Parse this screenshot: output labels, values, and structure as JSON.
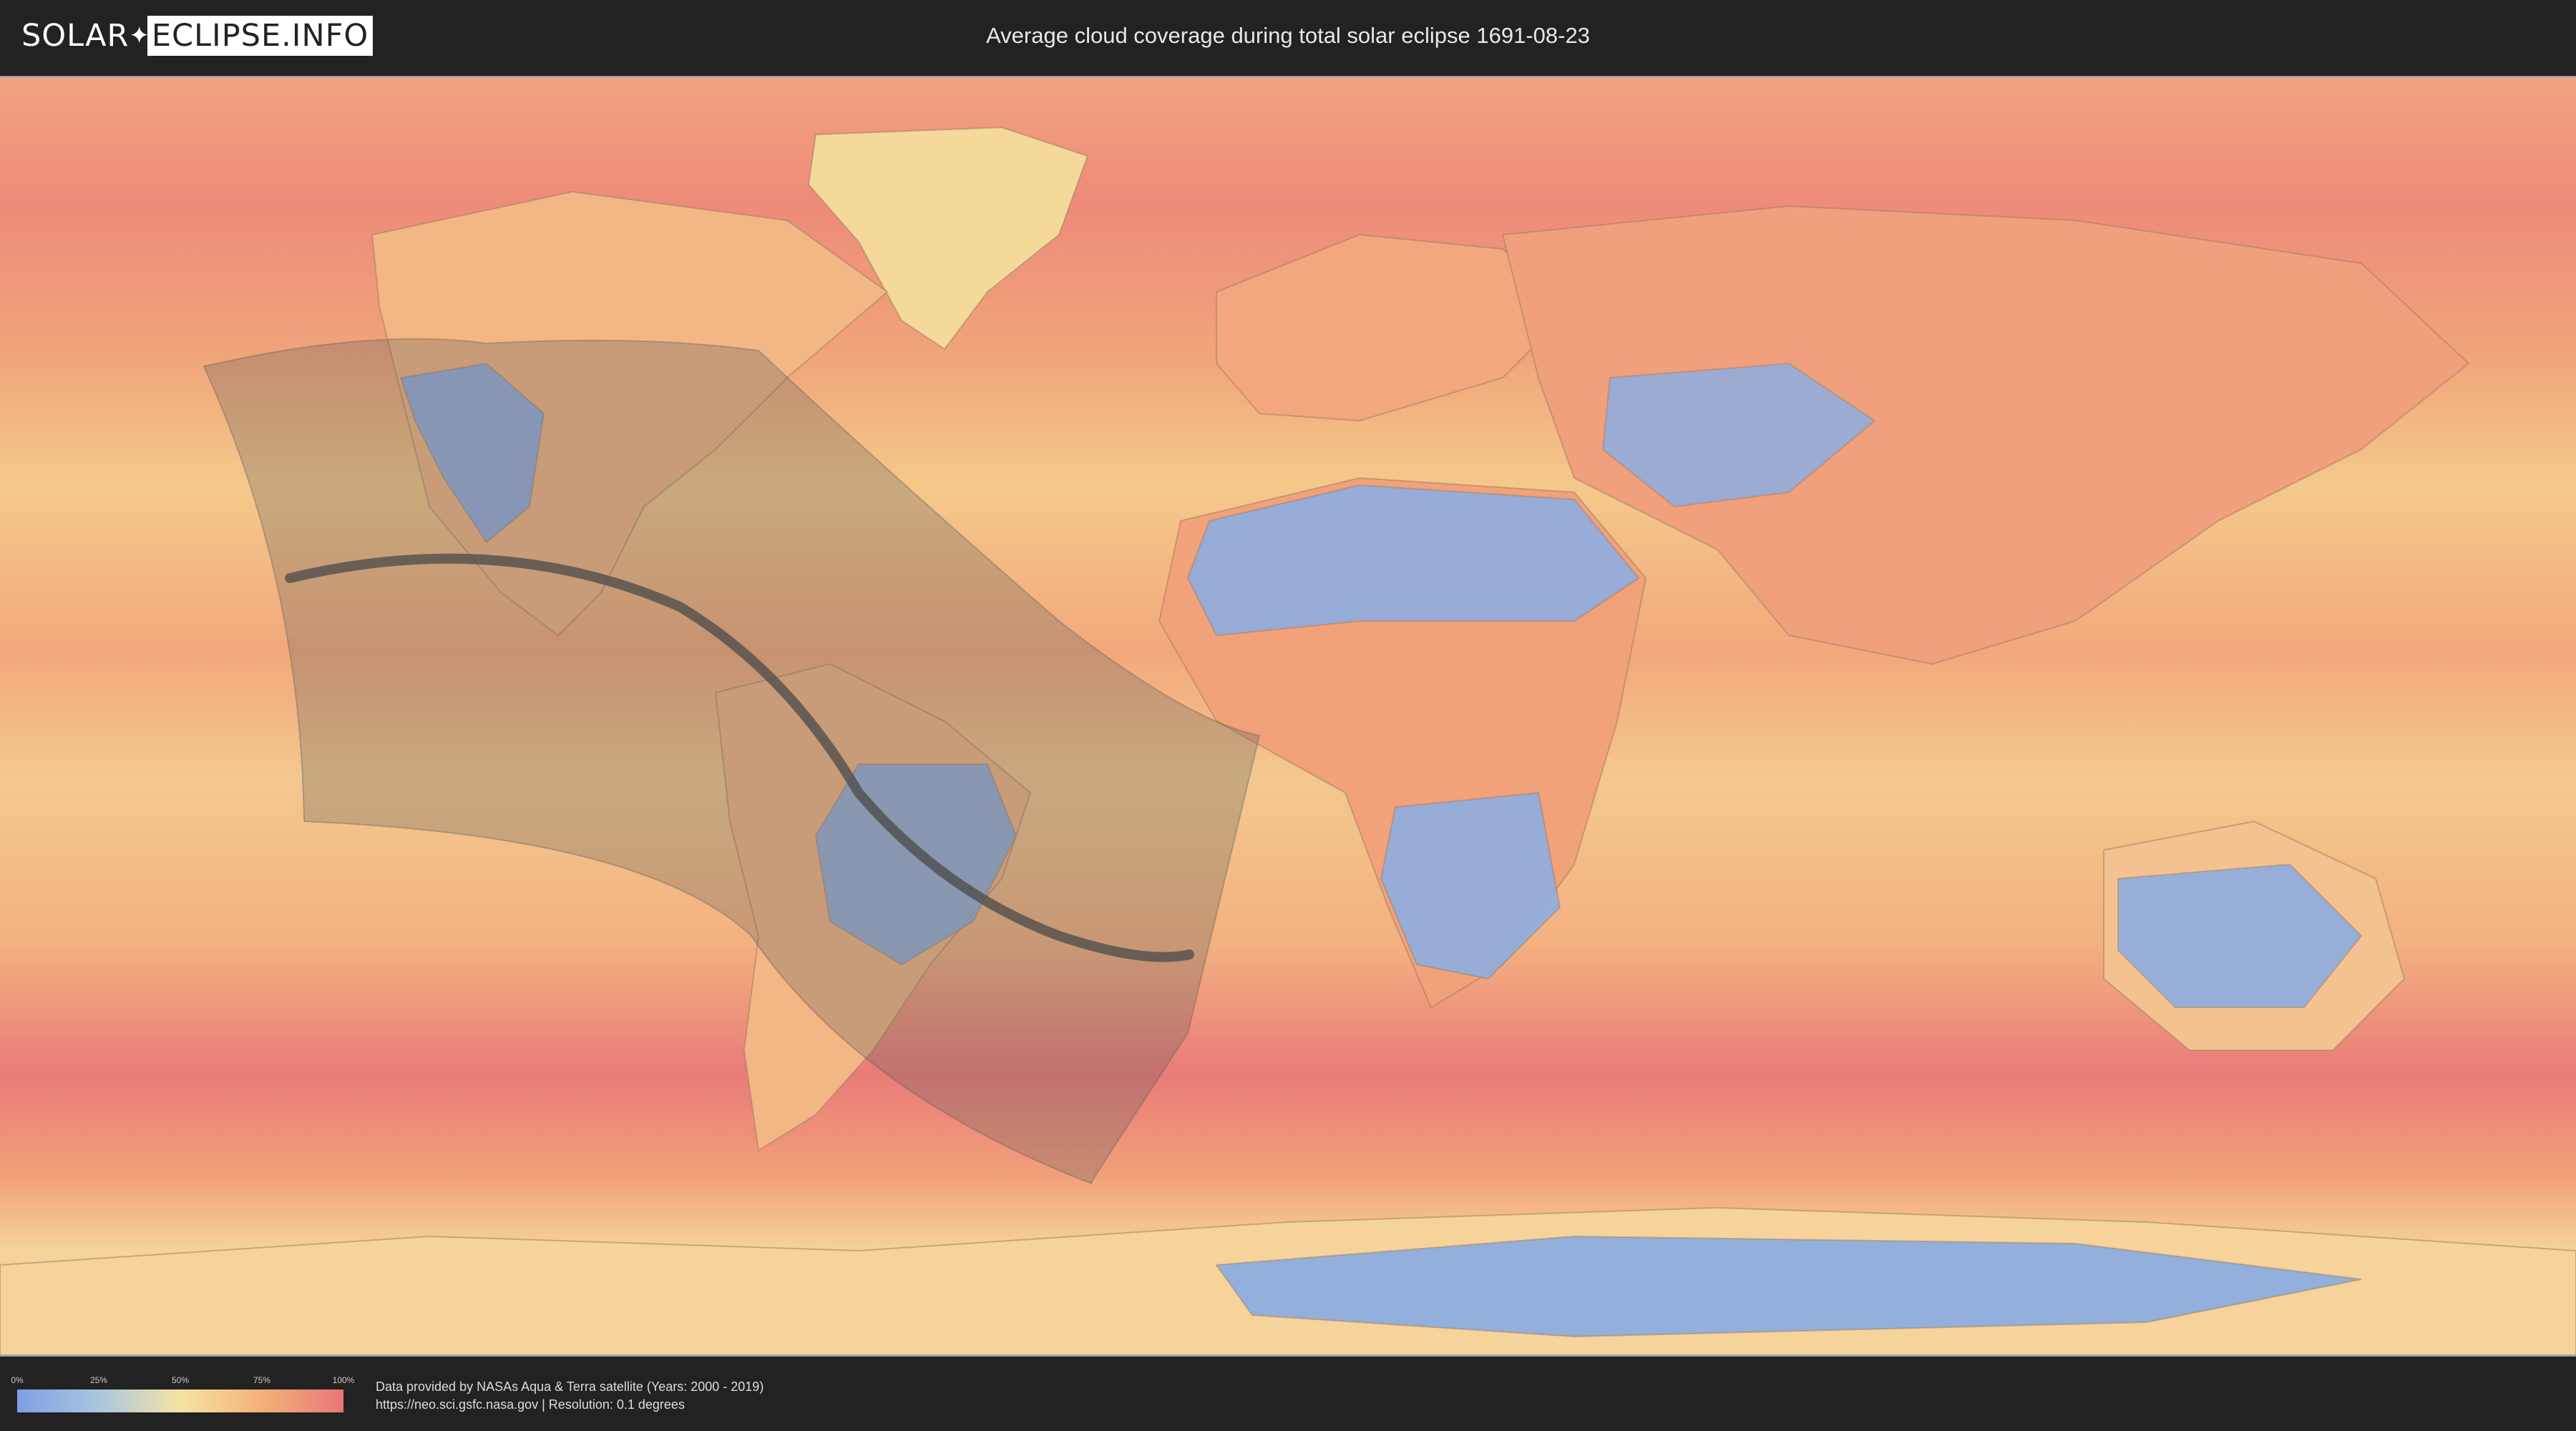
{
  "header": {
    "logo_left": "SOLAR",
    "logo_right": "ECLIPSE.INFO",
    "title": "Average cloud coverage during total solar eclipse 1691-08-23"
  },
  "map": {
    "overlay_color": "#5a5a5a",
    "path_color": "#4a4a4a",
    "ocean_color": "#f2a27a",
    "clear_color": "#8eaee0"
  },
  "legend": {
    "labels": [
      "0%",
      "25%",
      "50%",
      "75%",
      "100%"
    ],
    "gradient": [
      "#7f9fe6",
      "#a9c6e0",
      "#f6e3a3",
      "#f2b278",
      "#e9767a"
    ]
  },
  "credits": {
    "line1": "Data provided by NASAs Aqua & Terra satellite (Years: 2000 - 2019)",
    "line2": "https://neo.sci.gsfc.nasa.gov | Resolution: 0.1 degrees"
  }
}
